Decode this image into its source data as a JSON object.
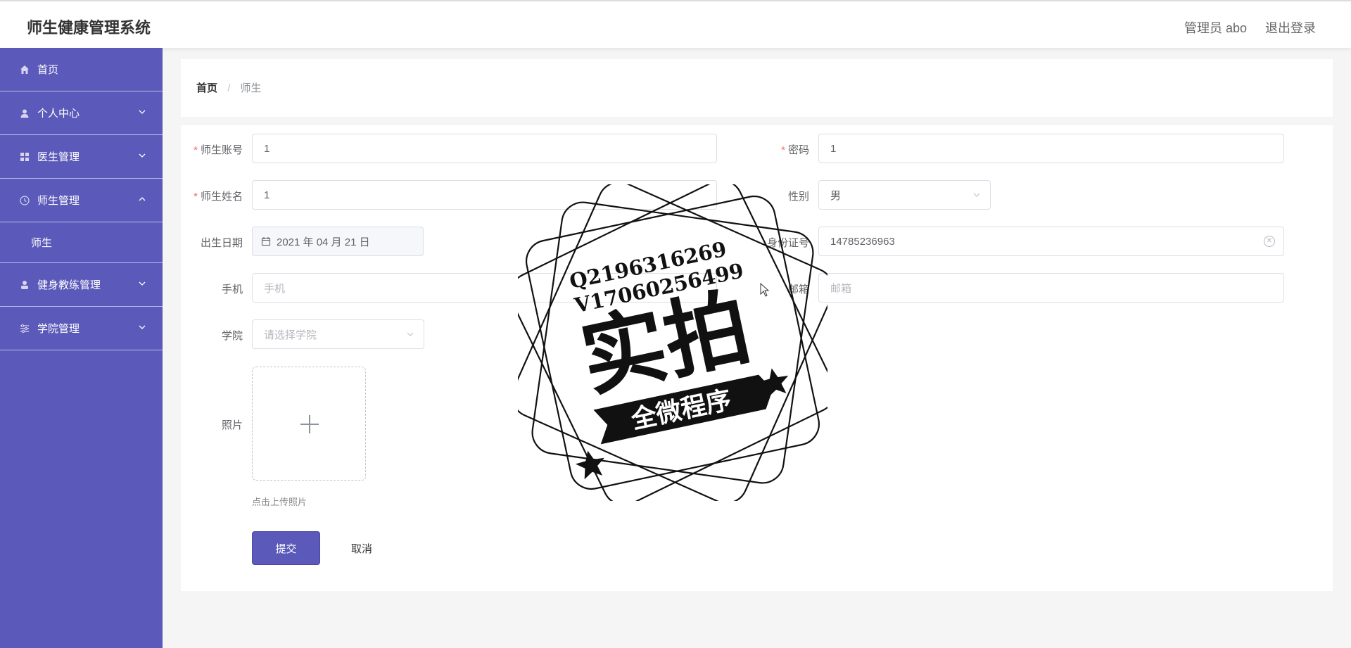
{
  "header": {
    "app_title": "师生健康管理系统",
    "user_label": "管理员 abo",
    "logout_label": "退出登录"
  },
  "sidebar": {
    "items": [
      {
        "label": "首页",
        "icon": "home-icon"
      },
      {
        "label": "个人中心",
        "icon": "user-icon"
      },
      {
        "label": "医生管理",
        "icon": "grid-icon"
      },
      {
        "label": "师生管理",
        "icon": "clock-icon",
        "expanded": true,
        "children": [
          {
            "label": "师生"
          }
        ]
      },
      {
        "label": "健身教练管理",
        "icon": "person-icon"
      },
      {
        "label": "学院管理",
        "icon": "sliders-icon"
      }
    ]
  },
  "breadcrumb": {
    "home": "首页",
    "separator": "/",
    "current": "师生"
  },
  "form": {
    "account": {
      "label": "师生账号",
      "value": "1",
      "required": true
    },
    "password": {
      "label": "密码",
      "value": "1",
      "required": true
    },
    "name": {
      "label": "师生姓名",
      "value": "1",
      "required": true
    },
    "gender": {
      "label": "性别",
      "value": "男"
    },
    "birth_date": {
      "label": "出生日期",
      "value": "2021 年 04 月 21 日"
    },
    "id_number": {
      "label": "身份证号",
      "value": "14785236963"
    },
    "phone": {
      "label": "手机",
      "placeholder": "手机"
    },
    "email": {
      "label": "邮箱",
      "placeholder": "邮箱"
    },
    "college": {
      "label": "学院",
      "placeholder": "请选择学院"
    },
    "photo": {
      "label": "照片",
      "hint": "点击上传照片"
    },
    "submit_label": "提交",
    "cancel_label": "取消"
  },
  "watermark": {
    "line1": "Q2196316269",
    "line2": "V17060256499",
    "main": "实拍",
    "banner": "全微程序"
  },
  "colors": {
    "accent": "#5b59b9",
    "required": "#f56c6c"
  }
}
